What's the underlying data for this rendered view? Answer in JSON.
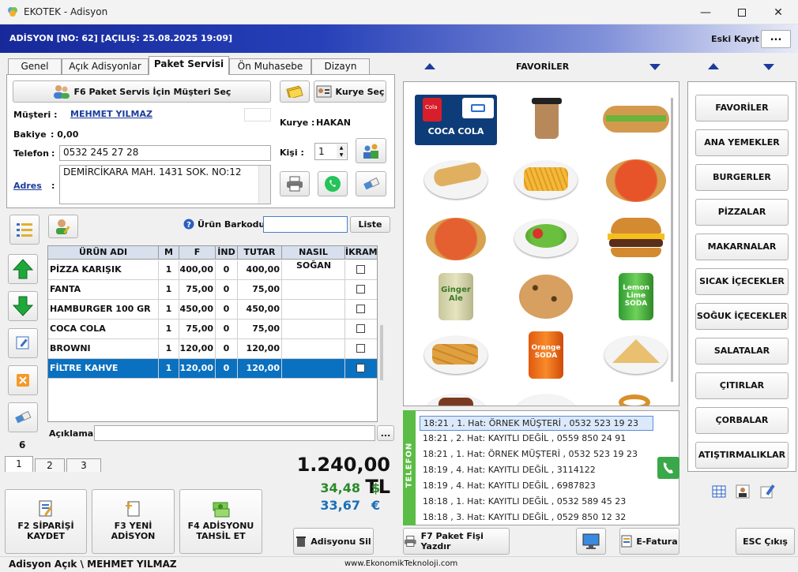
{
  "window": {
    "title": "EKOTEK - Adisyon"
  },
  "header": {
    "title": "ADİSYON [NO: 62] [AÇILIŞ: 25.08.2025 19:09]",
    "eski_kayit": "Eski Kayıt",
    "more": "..."
  },
  "tabs": [
    "Genel",
    "Açık Adisyonlar",
    "Paket Servisi",
    "Ön Muhasebe",
    "Dizayn"
  ],
  "customer": {
    "select_button": "F6 Paket Servis İçin Müşteri Seç",
    "courier_button": "Kurye Seç",
    "musteri_label": "Müşteri :",
    "musteri_value": "MEHMET YILMAZ",
    "bakiye_label": "Bakiye",
    "bakiye_value": ": 0,00",
    "telefon_label": "Telefon",
    "telefon_value": "0532 245 27 28",
    "adres_label": "Adres",
    "adres_value": "DEMİRCİKARA MAH. 1431 SOK. NO:12",
    "kurye_label": "Kurye :",
    "kurye_value": "HAKAN",
    "kisi_label": "Kişi :",
    "kisi_value": "1",
    "colon": ":"
  },
  "barcode": {
    "label": "Ürün Barkodu",
    "list_button": "Liste"
  },
  "order_table": {
    "headers": [
      "ÜRÜN ADI",
      "M",
      "F",
      "İND",
      "TUTAR",
      "NASIL",
      "İKRAM"
    ],
    "rows": [
      {
        "name": "PİZZA KARIŞIK",
        "m": "1",
        "f": "400,00",
        "ind": "0",
        "tutar": "400,00",
        "nasil": "SOĞAN"
      },
      {
        "name": "FANTA",
        "m": "1",
        "f": "75,00",
        "ind": "0",
        "tutar": "75,00",
        "nasil": ""
      },
      {
        "name": "HAMBURGER 100 GR",
        "m": "1",
        "f": "450,00",
        "ind": "0",
        "tutar": "450,00",
        "nasil": ""
      },
      {
        "name": "COCA COLA",
        "m": "1",
        "f": "75,00",
        "ind": "0",
        "tutar": "75,00",
        "nasil": ""
      },
      {
        "name": "BROWNI",
        "m": "1",
        "f": "120,00",
        "ind": "0",
        "tutar": "120,00",
        "nasil": ""
      },
      {
        "name": "FİLTRE KAHVE",
        "m": "1",
        "f": "120,00",
        "ind": "0",
        "tutar": "120,00",
        "nasil": ""
      }
    ],
    "selected_index": 5
  },
  "item_count": "6",
  "aciklama_label": "Açıklama",
  "aciklama_more": "...",
  "page_tabs": [
    "1",
    "2",
    "3"
  ],
  "totals": {
    "tl": "1.240,00 TL",
    "usd": "34,48",
    "usd_symbol": "$",
    "eur": "33,67",
    "eur_symbol": "€"
  },
  "action_buttons": {
    "save": [
      "F2 SİPARİŞİ",
      "KAYDET"
    ],
    "new": [
      "F3 YENİ",
      "ADİSYON"
    ],
    "pay": [
      "F4 ADİSYONU",
      "TAHSİL ET"
    ],
    "delete": "Adisyonu Sil",
    "print": "F7 Paket Fişi Yazdır",
    "efatura": "E-Fatura",
    "esc": "ESC Çıkış"
  },
  "favorites": {
    "title": "FAVORİLER",
    "selected_label": "COCA COLA",
    "tile_labels": [
      "Cola",
      "Ginger Ale",
      "Lemon Lime SODA",
      "Orange SODA"
    ]
  },
  "categories": [
    "FAVORİLER",
    "ANA YEMEKLER",
    "BURGERLER",
    "PİZZALAR",
    "MAKARNALAR",
    "SICAK İÇECEKLER",
    "SOĞUK İÇECEKLER",
    "SALATALAR",
    "ÇITIRLAR",
    "ÇORBALAR",
    "ATIŞTIRMALIKLAR"
  ],
  "phone": {
    "strip_label": "TELEFON",
    "calls": [
      "18:21 , 1. Hat: ÖRNEK MÜŞTERİ , 0532 523 19 23",
      "18:21 , 2. Hat: KAYITLI DEĞİL , 0559 850 24 91",
      "18:21 , 1. Hat: ÖRNEK MÜŞTERİ , 0532 523 19 23",
      "18:19 , 4. Hat: KAYITLI DEĞİL , 3114122",
      "18:19 , 4. Hat: KAYITLI DEĞİL , 6987823",
      "18:18 , 1. Hat: KAYITLI DEĞİL , 0532 589 45 23",
      "18:18 , 3. Hat: KAYITLI DEĞİL , 0529 850 12 32"
    ]
  },
  "status": {
    "left": "Adisyon Açık \\ MEHMET YILMAZ",
    "center": "www.EkonomikTeknoloji.com"
  },
  "colors": {
    "header_blue": "#17299a",
    "selection_blue": "#0a70c0",
    "usd_green": "#2a8a2a",
    "eur_blue": "#1a6fb8",
    "phone_green": "#5bbd45"
  }
}
